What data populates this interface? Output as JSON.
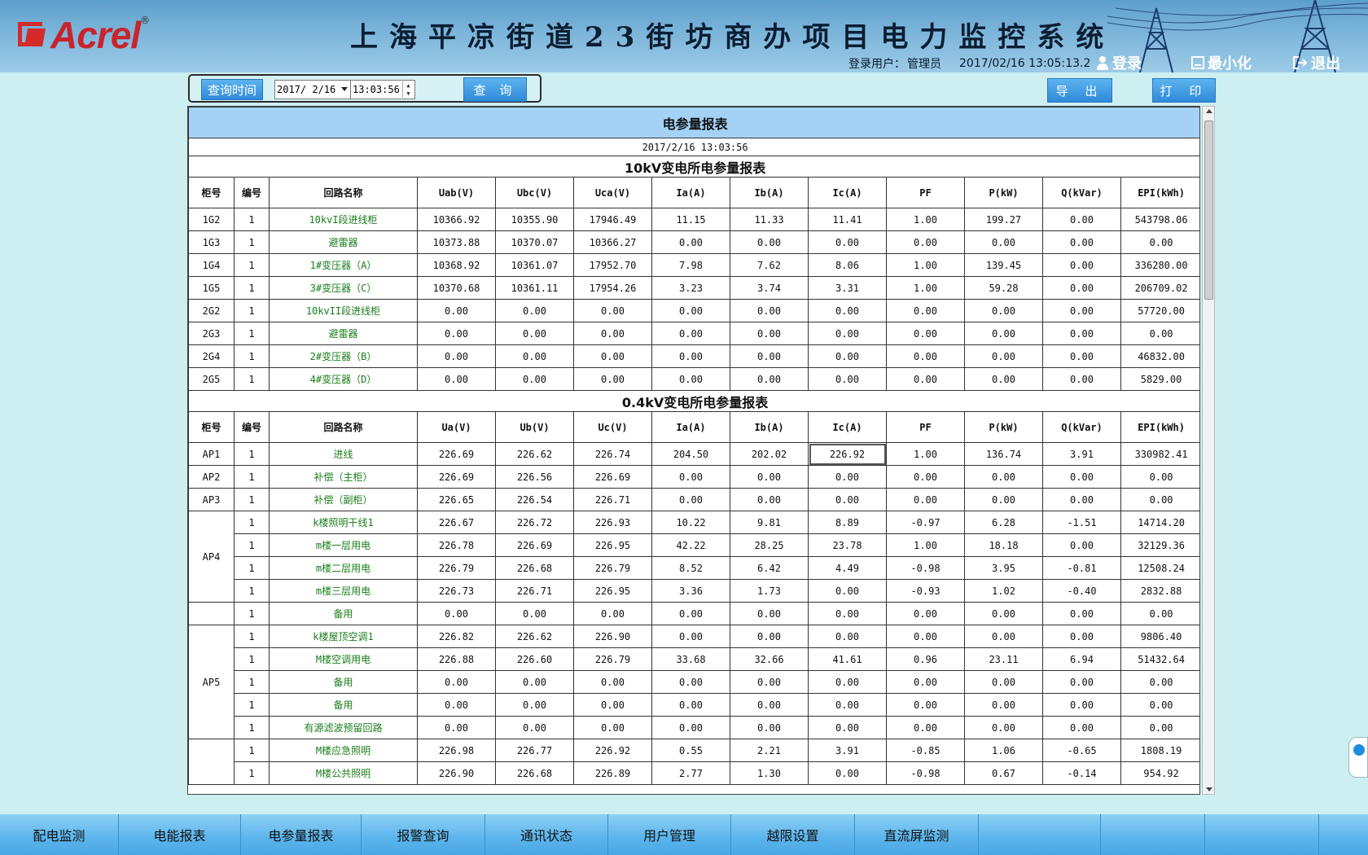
{
  "header": {
    "logo_text": "Acrel",
    "logo_reg": "®",
    "title": "上海平凉街道23街坊商办项目电力监控系统",
    "user_label": "登录用户：",
    "user_name": "管理员",
    "datetime": "2017/02/16  13:05:13.2",
    "login_label": "登录",
    "minimize_label": "最小化",
    "exit_label": "退出"
  },
  "query": {
    "time_label": "查询时间",
    "date_value": "2017/ 2/16",
    "time_value": "13:03:56",
    "query_label": "查 询",
    "export_label": "导 出",
    "print_label": "打 印"
  },
  "report": {
    "title": "电参量报表",
    "timestamp": "2017/2/16 13:03:56",
    "section1": {
      "title": "10kV变电所电参量报表",
      "headers": [
        "柜号",
        "编号",
        "回路名称",
        "Uab(V)",
        "Ubc(V)",
        "Uca(V)",
        "Ia(A)",
        "Ib(A)",
        "Ic(A)",
        "PF",
        "P(kW)",
        "Q(kVar)",
        "EPI(kWh)"
      ],
      "rows": [
        {
          "cab": "1G2",
          "no": "1",
          "name": "10kvI段进线柜",
          "v": [
            "10366.92",
            "10355.90",
            "17946.49",
            "11.15",
            "11.33",
            "11.41",
            "1.00",
            "199.27",
            "0.00",
            "543798.06"
          ]
        },
        {
          "cab": "1G3",
          "no": "1",
          "name": "避雷器",
          "v": [
            "10373.88",
            "10370.07",
            "10366.27",
            "0.00",
            "0.00",
            "0.00",
            "0.00",
            "0.00",
            "0.00",
            "0.00"
          ]
        },
        {
          "cab": "1G4",
          "no": "1",
          "name": "1#变压器（A）",
          "v": [
            "10368.92",
            "10361.07",
            "17952.70",
            "7.98",
            "7.62",
            "8.06",
            "1.00",
            "139.45",
            "0.00",
            "336280.00"
          ]
        },
        {
          "cab": "1G5",
          "no": "1",
          "name": "3#变压器（C）",
          "v": [
            "10370.68",
            "10361.11",
            "17954.26",
            "3.23",
            "3.74",
            "3.31",
            "1.00",
            "59.28",
            "0.00",
            "206709.02"
          ]
        },
        {
          "cab": "2G2",
          "no": "1",
          "name": "10kvII段进线柜",
          "v": [
            "0.00",
            "0.00",
            "0.00",
            "0.00",
            "0.00",
            "0.00",
            "0.00",
            "0.00",
            "0.00",
            "57720.00"
          ]
        },
        {
          "cab": "2G3",
          "no": "1",
          "name": "避雷器",
          "v": [
            "0.00",
            "0.00",
            "0.00",
            "0.00",
            "0.00",
            "0.00",
            "0.00",
            "0.00",
            "0.00",
            "0.00"
          ]
        },
        {
          "cab": "2G4",
          "no": "1",
          "name": "2#变压器（B）",
          "v": [
            "0.00",
            "0.00",
            "0.00",
            "0.00",
            "0.00",
            "0.00",
            "0.00",
            "0.00",
            "0.00",
            "46832.00"
          ]
        },
        {
          "cab": "2G5",
          "no": "1",
          "name": "4#变压器（D）",
          "v": [
            "0.00",
            "0.00",
            "0.00",
            "0.00",
            "0.00",
            "0.00",
            "0.00",
            "0.00",
            "0.00",
            "5829.00"
          ]
        }
      ]
    },
    "section2": {
      "title": "0.4kV变电所电参量报表",
      "headers": [
        "柜号",
        "编号",
        "回路名称",
        "Ua(V)",
        "Ub(V)",
        "Uc(V)",
        "Ia(A)",
        "Ib(A)",
        "Ic(A)",
        "PF",
        "P(kW)",
        "Q(kVar)",
        "EPI(kWh)"
      ],
      "rows": [
        {
          "cab": "AP1",
          "no": "1",
          "name": "进线",
          "v": [
            "226.69",
            "226.62",
            "226.74",
            "204.50",
            "202.02",
            "226.92",
            "1.00",
            "136.74",
            "3.91",
            "330982.41"
          ]
        },
        {
          "cab": "AP2",
          "no": "1",
          "name": "补偿（主柜）",
          "v": [
            "226.69",
            "226.56",
            "226.69",
            "0.00",
            "0.00",
            "0.00",
            "0.00",
            "0.00",
            "0.00",
            "0.00"
          ]
        },
        {
          "cab": "AP3",
          "no": "1",
          "name": "补偿（副柜）",
          "v": [
            "226.65",
            "226.54",
            "226.71",
            "0.00",
            "0.00",
            "0.00",
            "0.00",
            "0.00",
            "0.00",
            "0.00"
          ]
        },
        {
          "cab": "AP4",
          "span": 4,
          "no": "1",
          "name": "k楼照明干线1",
          "v": [
            "226.67",
            "226.72",
            "226.93",
            "10.22",
            "9.81",
            "8.89",
            "-0.97",
            "6.28",
            "-1.51",
            "14714.20"
          ]
        },
        {
          "no": "1",
          "name": "m楼一层用电",
          "v": [
            "226.78",
            "226.69",
            "226.95",
            "42.22",
            "28.25",
            "23.78",
            "1.00",
            "18.18",
            "0.00",
            "32129.36"
          ]
        },
        {
          "no": "1",
          "name": "m楼二层用电",
          "v": [
            "226.79",
            "226.68",
            "226.79",
            "8.52",
            "6.42",
            "4.49",
            "-0.98",
            "3.95",
            "-0.81",
            "12508.24"
          ]
        },
        {
          "no": "1",
          "name": "m楼三层用电",
          "v": [
            "226.73",
            "226.71",
            "226.95",
            "3.36",
            "1.73",
            "0.00",
            "-0.93",
            "1.02",
            "-0.40",
            "2832.88"
          ]
        },
        {
          "cab": "",
          "no": "1",
          "name": "备用",
          "v": [
            "0.00",
            "0.00",
            "0.00",
            "0.00",
            "0.00",
            "0.00",
            "0.00",
            "0.00",
            "0.00",
            "0.00"
          ]
        },
        {
          "cab": "AP5",
          "span": 5,
          "no": "1",
          "name": "k楼屋顶空调1",
          "v": [
            "226.82",
            "226.62",
            "226.90",
            "0.00",
            "0.00",
            "0.00",
            "0.00",
            "0.00",
            "0.00",
            "9806.40"
          ]
        },
        {
          "no": "1",
          "name": "M楼空调用电",
          "v": [
            "226.88",
            "226.60",
            "226.79",
            "33.68",
            "32.66",
            "41.61",
            "0.96",
            "23.11",
            "6.94",
            "51432.64"
          ]
        },
        {
          "no": "1",
          "name": "备用",
          "v": [
            "0.00",
            "0.00",
            "0.00",
            "0.00",
            "0.00",
            "0.00",
            "0.00",
            "0.00",
            "0.00",
            "0.00"
          ]
        },
        {
          "no": "1",
          "name": "备用",
          "v": [
            "0.00",
            "0.00",
            "0.00",
            "0.00",
            "0.00",
            "0.00",
            "0.00",
            "0.00",
            "0.00",
            "0.00"
          ]
        },
        {
          "no": "1",
          "name": "有源滤波预留回路",
          "v": [
            "0.00",
            "0.00",
            "0.00",
            "0.00",
            "0.00",
            "0.00",
            "0.00",
            "0.00",
            "0.00",
            "0.00"
          ]
        },
        {
          "cab": "",
          "span": 3,
          "no": "1",
          "name": "M楼应急照明",
          "v": [
            "226.98",
            "226.77",
            "226.92",
            "0.55",
            "2.21",
            "3.91",
            "-0.85",
            "1.06",
            "-0.65",
            "1808.19"
          ]
        },
        {
          "no": "1",
          "name": "M楼公共照明",
          "v": [
            "226.90",
            "226.68",
            "226.89",
            "2.77",
            "1.30",
            "0.00",
            "-0.98",
            "0.67",
            "-0.14",
            "954.92"
          ]
        }
      ]
    }
  },
  "nav": {
    "items": [
      "配电监测",
      "电能报表",
      "电参量报表",
      "报警查询",
      "通讯状态",
      "用户管理",
      "越限设置",
      "直流屏监测",
      "",
      "",
      ""
    ]
  },
  "colors": {
    "header_bg": "#6fabd4",
    "body_bg": "#cdeff2",
    "title_row_bg": "#a4d2f7",
    "name_text": "#1a7e1a",
    "logo_red": "#c8242b"
  },
  "icons": [
    "user-icon",
    "minimize-icon",
    "exit-icon",
    "dropdown-arrow-icon",
    "spin-up-icon",
    "spin-down-icon"
  ]
}
